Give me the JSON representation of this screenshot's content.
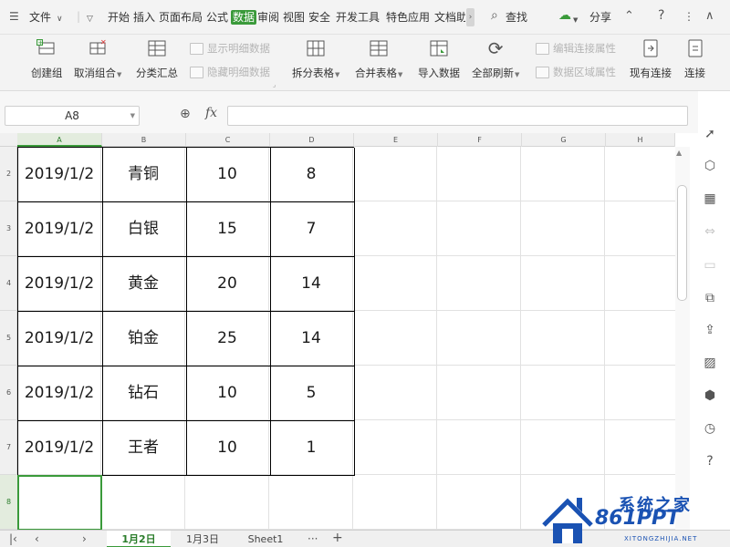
{
  "menubar": {
    "file_label": "文件",
    "tabs": [
      {
        "label": "开始"
      },
      {
        "label": "插入"
      },
      {
        "label": "页面布局"
      },
      {
        "label": "公式"
      },
      {
        "label": "数据"
      },
      {
        "label": "审阅"
      },
      {
        "label": "视图"
      },
      {
        "label": "安全"
      },
      {
        "label": "开发工具"
      },
      {
        "label": "特色应用"
      },
      {
        "label": "文档助"
      }
    ],
    "active_tab": "数据",
    "search_label": "查找",
    "share_label": "分享"
  },
  "ribbon": {
    "create_group": "创建组",
    "ungroup": "取消组合",
    "subtotal": "分类汇总",
    "show_detail": "显示明细数据",
    "hide_detail": "隐藏明细数据",
    "split_table": "拆分表格",
    "merge_table": "合并表格",
    "import_data": "导入数据",
    "refresh_all": "全部刷新",
    "edit_link_props": "编辑连接属性",
    "data_range_props": "数据区域属性",
    "existing_connection": "现有连接",
    "connect": "连接"
  },
  "formula_bar": {
    "name_box": "A8",
    "fx_label": "fx",
    "formula": ""
  },
  "grid": {
    "columns": [
      "A",
      "B",
      "C",
      "D",
      "E",
      "F",
      "G",
      "H"
    ],
    "row_numbers": [
      "2",
      "3",
      "4",
      "5",
      "6",
      "7",
      "8"
    ],
    "selected_column": "A",
    "selected_row": "8",
    "rows": [
      [
        "2019/1/2",
        "青铜",
        "10",
        "8"
      ],
      [
        "2019/1/2",
        "白银",
        "15",
        "7"
      ],
      [
        "2019/1/2",
        "黄金",
        "20",
        "14"
      ],
      [
        "2019/1/2",
        "铂金",
        "25",
        "14"
      ],
      [
        "2019/1/2",
        "钻石",
        "10",
        "5"
      ],
      [
        "2019/1/2",
        "王者",
        "10",
        "1"
      ]
    ]
  },
  "sheet_tabs": [
    {
      "label": "1月2日",
      "active": true
    },
    {
      "label": "1月3日",
      "active": false
    },
    {
      "label": "Sheet1",
      "active": false
    }
  ],
  "sheet_more": "···",
  "sheet_add": "+",
  "watermark": {
    "title": "系统之家",
    "domain": "861PPT",
    "pinyin": "XITONGZHIJIA.NET"
  },
  "colors": {
    "accent": "#3a9a3a",
    "watermark_blue": "#1a52b3"
  }
}
